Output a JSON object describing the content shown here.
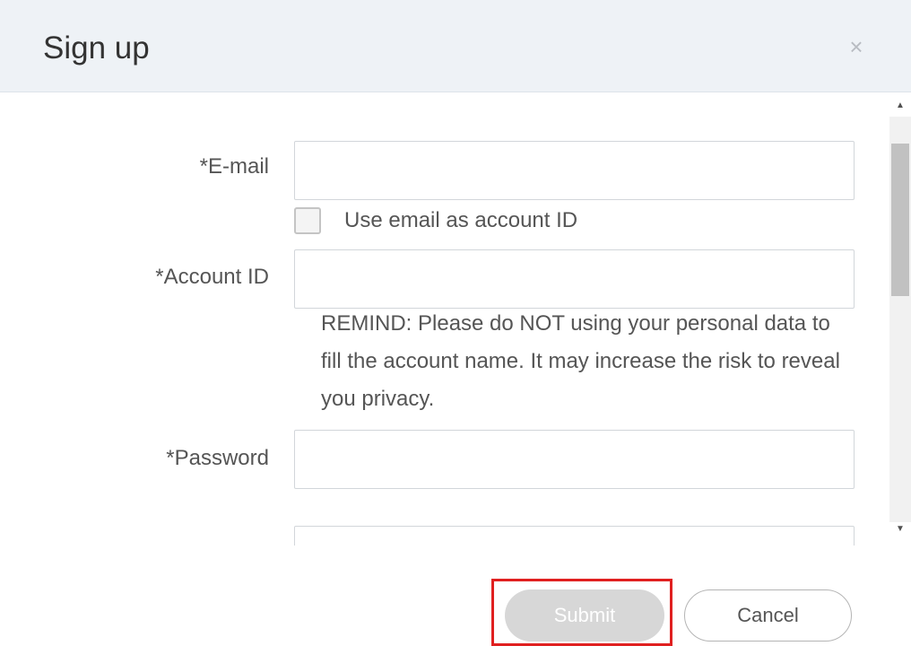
{
  "dialog": {
    "title": "Sign up",
    "close_icon": "close-icon",
    "close_glyph": "×"
  },
  "form": {
    "email": {
      "label": "*E-mail",
      "value": "",
      "placeholder": ""
    },
    "use_email_checkbox": {
      "label": "Use email as account ID",
      "checked": false
    },
    "account_id": {
      "label": "*Account ID",
      "value": "",
      "placeholder": ""
    },
    "remind_text": "REMIND: Please do NOT using your personal data to fill the account name. It may increase the risk to reveal you privacy.",
    "password": {
      "label": "*Password",
      "value": "",
      "placeholder": ""
    },
    "confirm_password": {
      "value": "",
      "placeholder": ""
    }
  },
  "scrollbar": {
    "up_icon": "scroll-up-arrow-icon",
    "down_icon": "scroll-down-arrow-icon",
    "up_glyph": "▲",
    "down_glyph": "▼"
  },
  "footer": {
    "submit_label": "Submit",
    "submit_state": "disabled",
    "cancel_label": "Cancel"
  },
  "colors": {
    "header_bg": "#eef2f6",
    "submit_bg": "#d7d7d7",
    "highlight": "#e02020"
  }
}
